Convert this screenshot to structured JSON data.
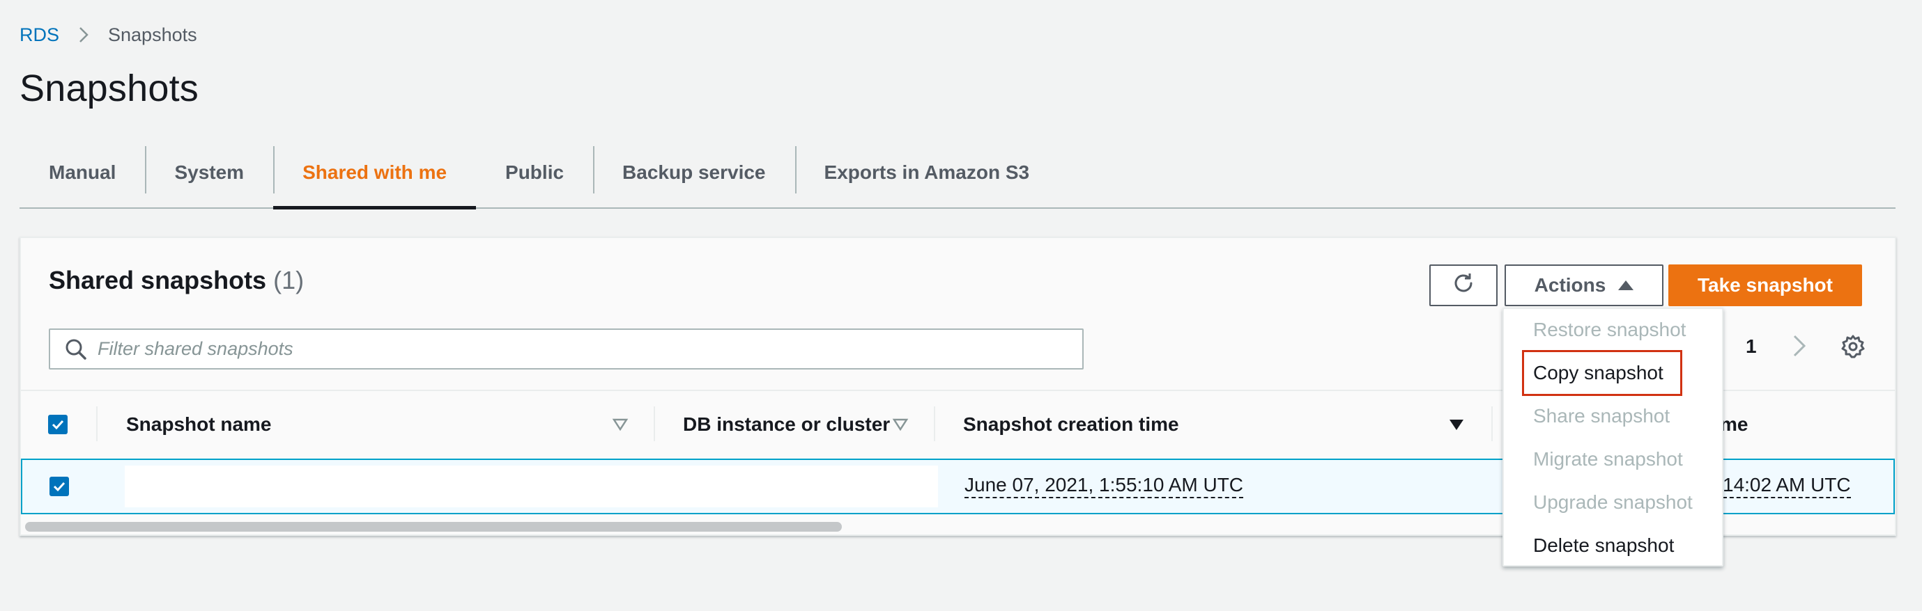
{
  "breadcrumb": {
    "root": "RDS",
    "current": "Snapshots"
  },
  "page": {
    "title": "Snapshots"
  },
  "tabs": [
    {
      "label": "Manual",
      "active": false
    },
    {
      "label": "System",
      "active": false
    },
    {
      "label": "Shared with me",
      "active": true
    },
    {
      "label": "Public",
      "active": false
    },
    {
      "label": "Backup service",
      "active": false
    },
    {
      "label": "Exports in Amazon S3",
      "active": false
    }
  ],
  "panel": {
    "title": "Shared snapshots",
    "count": "(1)",
    "refresh_icon": "refresh-icon",
    "actions_label": "Actions",
    "take_snapshot_label": "Take snapshot",
    "search_placeholder": "Filter shared snapshots",
    "page_number": "1"
  },
  "table": {
    "columns": [
      {
        "label": "Snapshot name",
        "sort": "sortable"
      },
      {
        "label": "DB instance or cluster",
        "sort": "sortable"
      },
      {
        "label": "Snapshot creation time",
        "sort": "descending"
      },
      {
        "label": "me",
        "sort": "none"
      }
    ],
    "rows": [
      {
        "selected": true,
        "snapshot_name": "",
        "db_instance": "",
        "creation_time": "June 07, 2021, 1:55:10 AM UTC",
        "partial_time": "14:02 AM UTC"
      }
    ]
  },
  "actions_menu": [
    {
      "label": "Restore snapshot",
      "enabled": false
    },
    {
      "label": "Copy snapshot",
      "enabled": true,
      "highlighted": true
    },
    {
      "label": "Share snapshot",
      "enabled": false
    },
    {
      "label": "Migrate snapshot",
      "enabled": false
    },
    {
      "label": "Upgrade snapshot",
      "enabled": false
    },
    {
      "label": "Delete snapshot",
      "enabled": true
    }
  ],
  "colors": {
    "accent_orange": "#ec7211",
    "link_blue": "#0073bb",
    "checkbox_blue": "#0073bb",
    "selected_row_border": "#00a1c9",
    "highlight_red": "#d13212"
  }
}
